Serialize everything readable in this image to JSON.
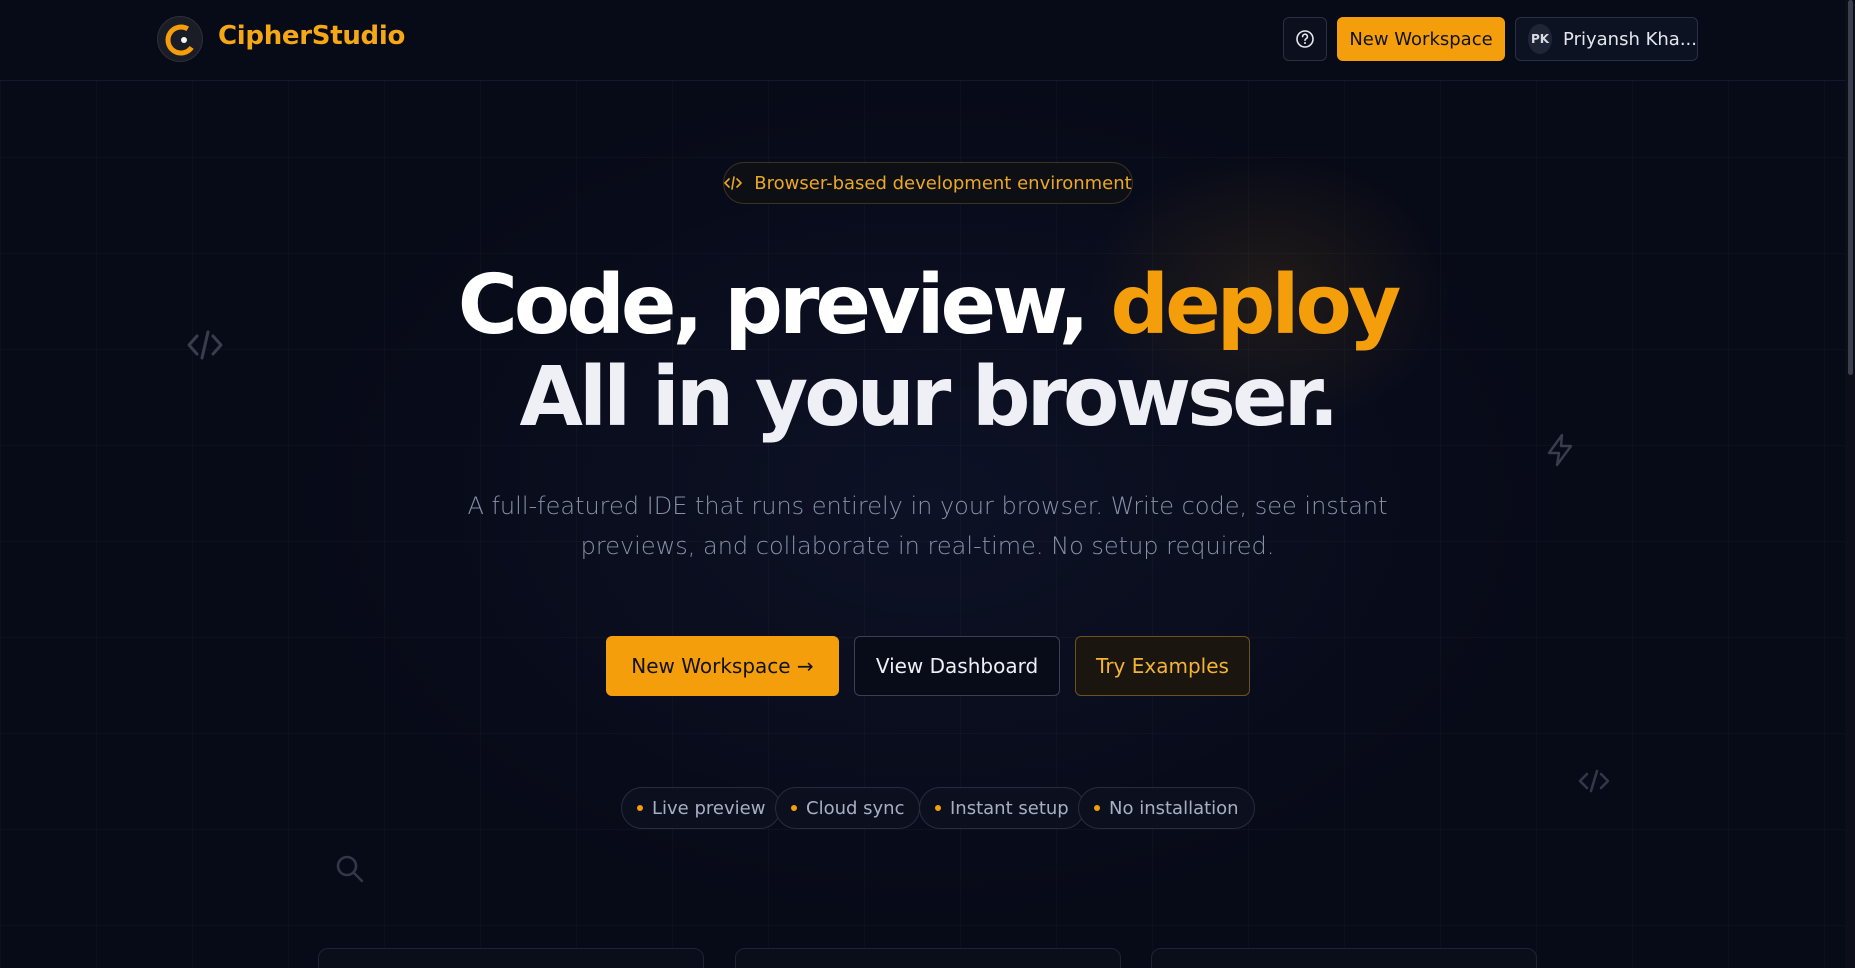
{
  "header": {
    "brand": "CipherStudio",
    "help_icon": "question-circle-icon",
    "new_workspace_label": "New Workspace",
    "user": {
      "initials": "PK",
      "name": "Priyansh Kha..."
    }
  },
  "hero": {
    "pill_icon": "code-icon",
    "pill_text": "Browser-based development environment",
    "title_line1_prefix": "Code, preview, ",
    "title_line1_accent": "deploy",
    "title_line2": "All in your browser.",
    "subtitle_line1": "A full-featured IDE that runs entirely in your browser. Write code, see instant",
    "subtitle_line2": "previews, and collaborate in real-time. No setup required.",
    "cta_new": "New Workspace →",
    "cta_dashboard": "View Dashboard",
    "cta_examples": "Try Examples",
    "features": [
      "Live preview",
      "Cloud sync",
      "Instant setup",
      "No installation"
    ]
  },
  "decorations": [
    "code-icon",
    "lightning-icon",
    "code-icon",
    "search-icon"
  ],
  "colors": {
    "accent": "#f59e0b",
    "background": "#070a17"
  }
}
